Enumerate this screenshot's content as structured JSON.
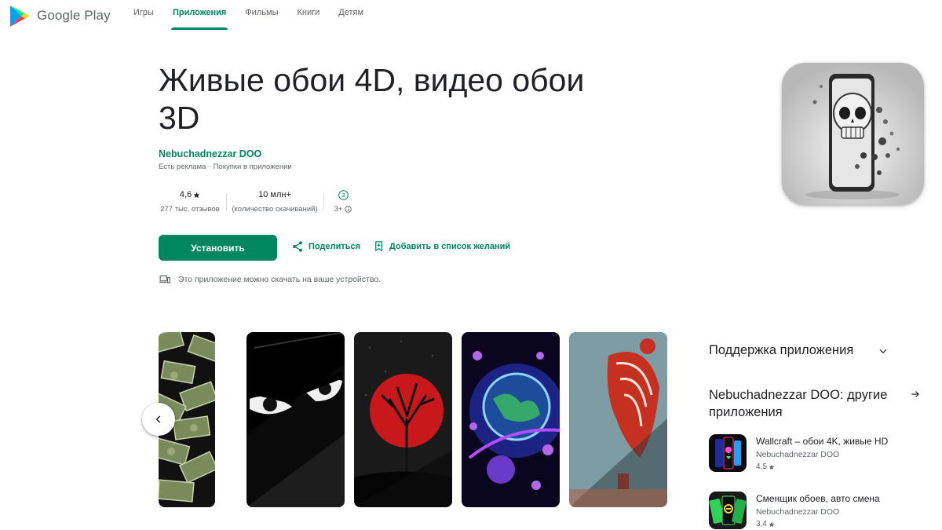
{
  "header": {
    "brand": "Google Play",
    "nav": [
      "Игры",
      "Приложения",
      "Фильмы",
      "Книги",
      "Детям"
    ],
    "active_nav": "Приложения"
  },
  "app": {
    "title": "Живые обои 4D, видео обои 3D",
    "developer": "Nebuchadnezzar DOO",
    "ads_label": "Есть реклама",
    "separator": "·",
    "iap_label": "Покупки в приложении",
    "rating": "4,6",
    "reviews": "277 тыс. отзывов",
    "downloads": "10 млн+",
    "downloads_label": "(количество скачиваний)",
    "age_badge": "3",
    "age": "3+",
    "install_label": "Установить",
    "share_label": "Поделиться",
    "wishlist_label": "Добавить в список желаний",
    "device_note": "Это приложение можно скачать на ваше устройство."
  },
  "sidebar": {
    "support_title": "Поддержка приложения",
    "other_apps_title": "Nebuchadnezzar DOO: другие приложения",
    "related": [
      {
        "name": "Wallcraft – обои 4K, живые HD",
        "developer": "Nebuchadnezzar DOO",
        "rating": "4,5"
      },
      {
        "name": "Сменщик обоев, авто смена",
        "developer": "Nebuchadnezzar DOO",
        "rating": "3,4"
      }
    ]
  },
  "colors": {
    "accent": "#01875f",
    "text": "#202124",
    "secondary": "#5f6368"
  }
}
